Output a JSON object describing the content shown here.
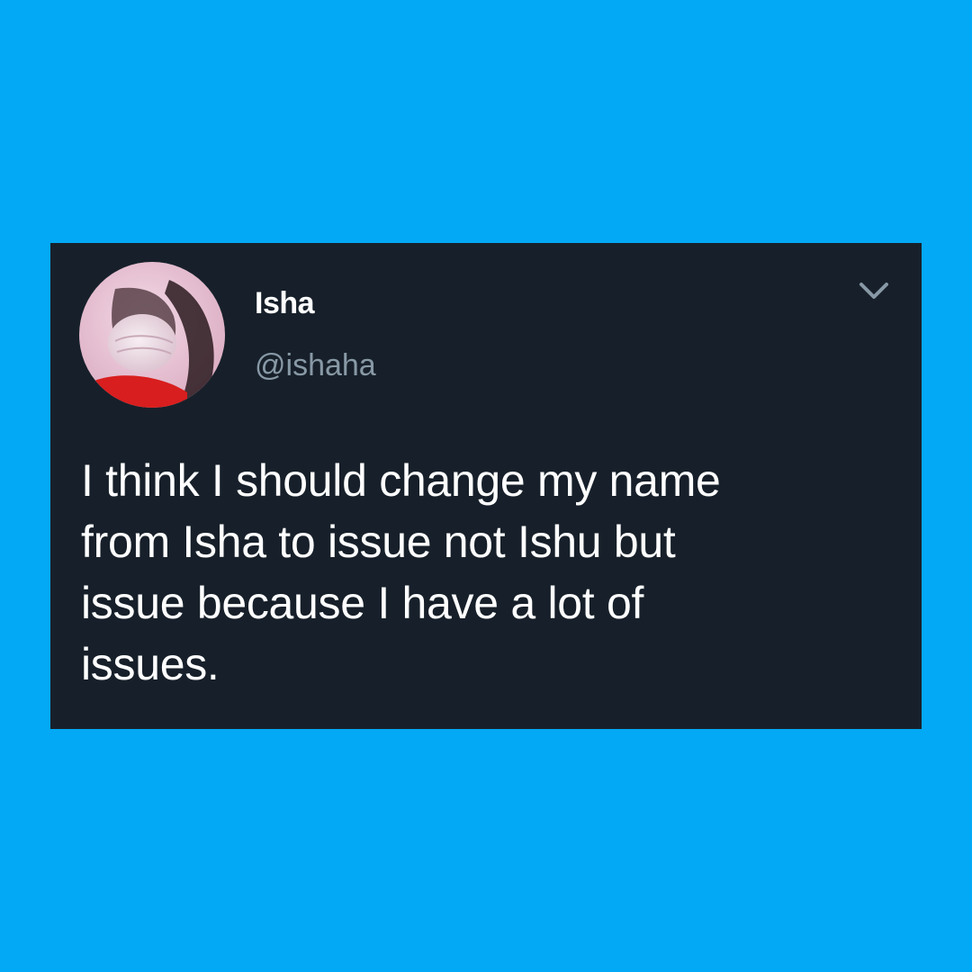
{
  "colors": {
    "page_background": "#03a9f4",
    "card_background": "#17202a",
    "name_text": "#ffffff",
    "handle_text": "#8899a6",
    "body_text": "#ffffff",
    "chevron": "#8899a6"
  },
  "tweet": {
    "author": {
      "display_name": "Isha",
      "handle": "@ishaha",
      "avatar_icon": "profile-photo-avatar"
    },
    "menu_icon": "chevron-down-icon",
    "text": "I think I should change my name\nfrom Isha to issue not Ishu but\nissue because I have a lot of\nissues."
  }
}
